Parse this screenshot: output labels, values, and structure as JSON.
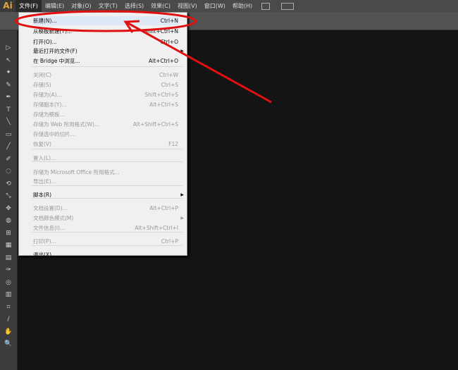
{
  "app": {
    "logo": "Ai"
  },
  "menubar": [
    "文件(F)",
    "编辑(E)",
    "对象(O)",
    "文字(T)",
    "选择(S)",
    "效果(C)",
    "视图(V)",
    "窗口(W)",
    "帮助(H)"
  ],
  "file_menu": [
    {
      "label": "新建(N)...",
      "shortcut": "Ctrl+N",
      "enabled": true,
      "highlighted": true
    },
    {
      "label": "从模板新建(T)...",
      "shortcut": "Shift+Ctrl+N",
      "enabled": true
    },
    {
      "label": "打开(O)...",
      "shortcut": "Ctrl+O",
      "enabled": true
    },
    {
      "label": "最近打开的文件(F)",
      "shortcut": "",
      "enabled": true,
      "submenu": true
    },
    {
      "label": "在 Bridge 中浏览...",
      "shortcut": "Alt+Ctrl+O",
      "enabled": true
    },
    {
      "label": "关闭(C)",
      "shortcut": "Ctrl+W",
      "enabled": false
    },
    {
      "label": "存储(S)",
      "shortcut": "Ctrl+S",
      "enabled": false
    },
    {
      "label": "存储为(A)...",
      "shortcut": "Shift+Ctrl+S",
      "enabled": false
    },
    {
      "label": "存储副本(Y)...",
      "shortcut": "Alt+Ctrl+S",
      "enabled": false
    },
    {
      "label": "存储为模板...",
      "shortcut": "",
      "enabled": false
    },
    {
      "label": "存储为 Web 所用格式(W)...",
      "shortcut": "Alt+Shift+Ctrl+S",
      "enabled": false
    },
    {
      "label": "存储选中的切片...",
      "shortcut": "",
      "enabled": false
    },
    {
      "label": "恢复(V)",
      "shortcut": "F12",
      "enabled": false
    },
    {
      "label": "置入(L)...",
      "shortcut": "",
      "enabled": false
    },
    {
      "label": "存储为 Microsoft Office 所用格式...",
      "shortcut": "",
      "enabled": false
    },
    {
      "label": "导出(E)...",
      "shortcut": "",
      "enabled": false
    },
    {
      "label": "脚本(R)",
      "shortcut": "",
      "enabled": true,
      "submenu": true
    },
    {
      "label": "文档设置(D)...",
      "shortcut": "Alt+Ctrl+P",
      "enabled": false
    },
    {
      "label": "文档颜色模式(M)",
      "shortcut": "",
      "enabled": false,
      "submenu": true
    },
    {
      "label": "文件信息(I)...",
      "shortcut": "Alt+Shift+Ctrl+I",
      "enabled": false
    },
    {
      "label": "打印(P)...",
      "shortcut": "Ctrl+P",
      "enabled": false
    },
    {
      "label": "退出(X)",
      "shortcut": "",
      "enabled": true
    }
  ],
  "annotation_color": "#e01010"
}
